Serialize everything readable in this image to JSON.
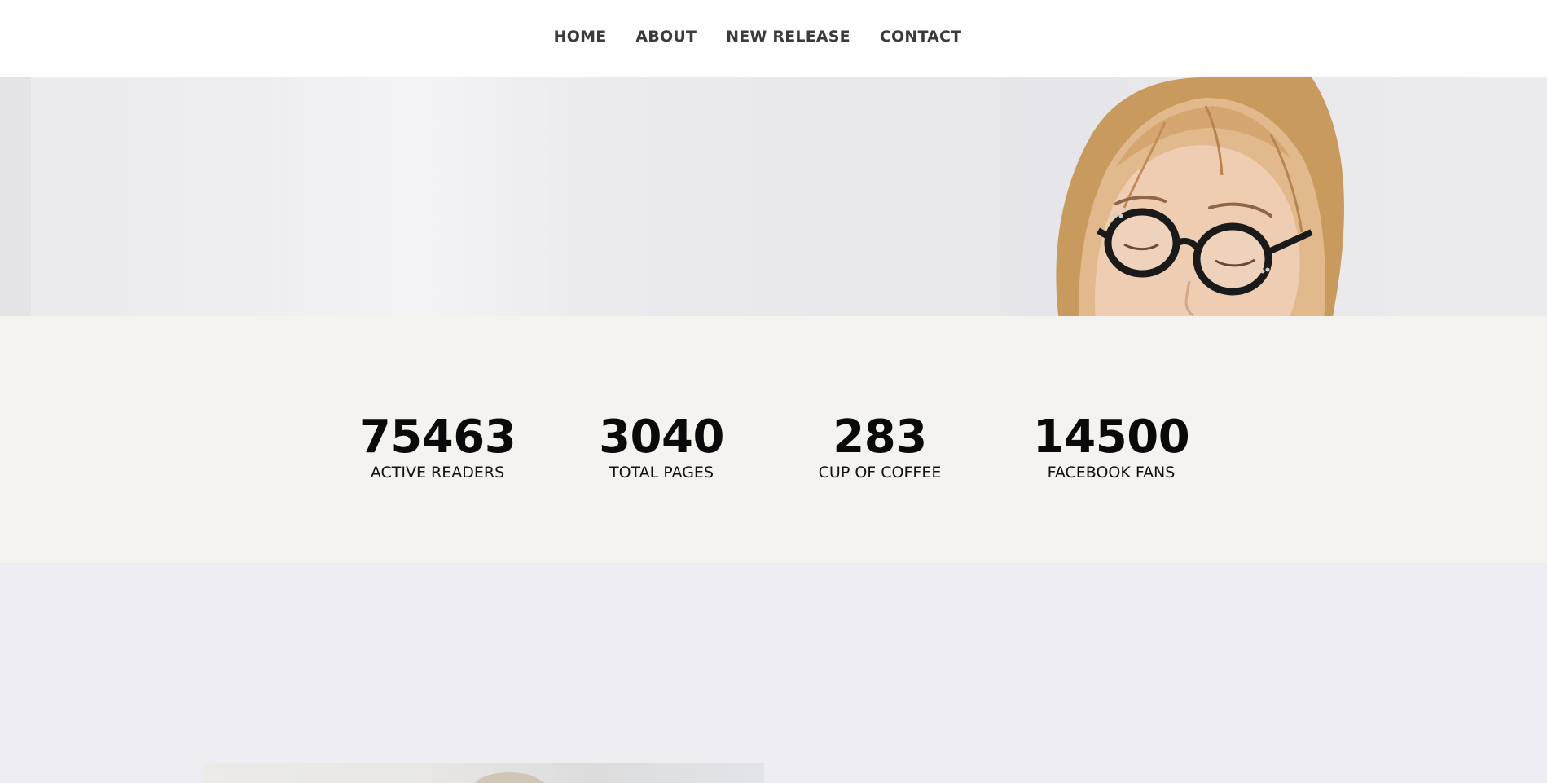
{
  "nav": {
    "items": [
      {
        "label": "HOME"
      },
      {
        "label": "ABOUT"
      },
      {
        "label": "NEW RELEASE"
      },
      {
        "label": "CONTACT"
      }
    ]
  },
  "stats": [
    {
      "value": "75463",
      "label": "ACTIVE READERS"
    },
    {
      "value": "3040",
      "label": "TOTAL PAGES"
    },
    {
      "value": "283",
      "label": "CUP OF COFFEE"
    },
    {
      "value": "14500",
      "label": "FACEBOOK FANS"
    }
  ],
  "colors": {
    "nav_text": "#3b3b3b",
    "hero_bg": "#eaeaed",
    "stats_bg": "#f4f3f0",
    "stat_text": "#0a0a0a",
    "lower_bg": "#eeedf1"
  }
}
